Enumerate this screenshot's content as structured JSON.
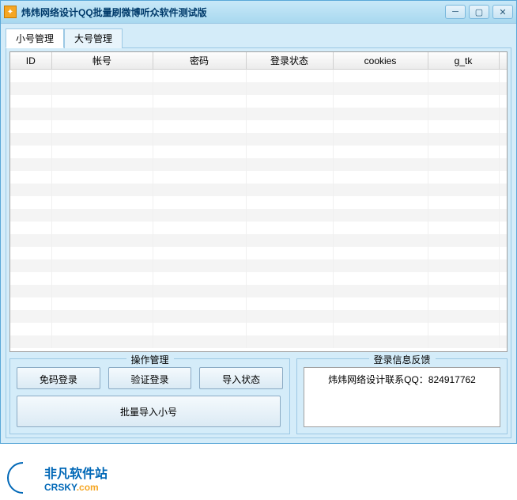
{
  "window": {
    "title": "炜炜网络设计QQ批量刷微博听众软件测试版"
  },
  "tabs": {
    "tab1": "小号管理",
    "tab2": "大号管理"
  },
  "table": {
    "headers": {
      "id": "ID",
      "account": "帐号",
      "password": "密码",
      "loginStatus": "登录状态",
      "cookies": "cookies",
      "gtk": "g_tk"
    }
  },
  "ops": {
    "legend": "操作管理",
    "btn1": "免码登录",
    "btn2": "验证登录",
    "btn3": "导入状态",
    "btnWide": "批量导入小号"
  },
  "feedback": {
    "legend": "登录信息反馈",
    "text": "炜炜网络设计联系QQ：824917762"
  },
  "footer": {
    "brandCn": "非凡软件站",
    "brandEn1": "CRSKY",
    "brandEn2": ".com"
  }
}
